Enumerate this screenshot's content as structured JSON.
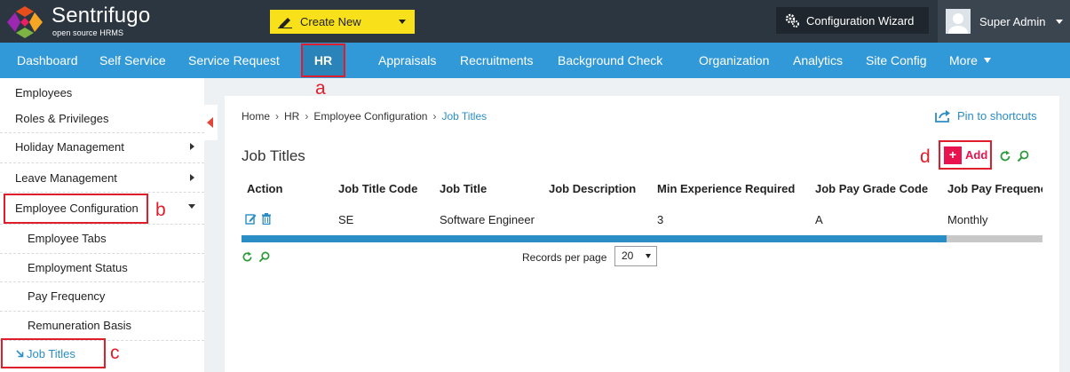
{
  "app": {
    "brand": "Sentrifugo",
    "tagline": "open source HRMS",
    "create_new": "Create New",
    "config_wizard": "Configuration Wizard",
    "user_name": "Super Admin"
  },
  "nav": {
    "items": [
      "Dashboard",
      "Self Service",
      "Service Request",
      "HR",
      "Appraisals",
      "Recruitments",
      "Background Check",
      "Organization",
      "Analytics",
      "Site Config",
      "More"
    ],
    "active": "HR"
  },
  "sidebar": {
    "items": [
      {
        "label": "Employees"
      },
      {
        "label": "Roles & Privileges"
      },
      {
        "label": "Holiday Management"
      },
      {
        "label": "Leave Management"
      },
      {
        "label": "Employee Configuration"
      },
      {
        "label": "Employee Tabs"
      },
      {
        "label": "Employment Status"
      },
      {
        "label": "Pay Frequency"
      },
      {
        "label": "Remuneration Basis"
      },
      {
        "label": "Job Titles"
      }
    ]
  },
  "breadcrumb": [
    "Home",
    "HR",
    "Employee Configuration",
    "Job Titles"
  ],
  "pin_label": "Pin to shortcuts",
  "page_title": "Job Titles",
  "add_label": "Add",
  "table": {
    "headers": [
      "Action",
      "Job Title Code",
      "Job Title",
      "Job Description",
      "Min Experience Required",
      "Job Pay Grade Code",
      "Job Pay Frequenc"
    ],
    "rows": [
      {
        "code": "SE",
        "title": "Software Engineer",
        "description": "",
        "min_experience": "3",
        "pay_grade": "A",
        "pay_frequency": "Monthly"
      }
    ]
  },
  "pagination": {
    "records_label": "Records per page",
    "records_value": "20"
  },
  "annotations": [
    "a",
    "b",
    "c",
    "d"
  ],
  "colors": {
    "topbar": "#2c3640",
    "navbar": "#3299d8",
    "accent_yellow": "#f8e11b",
    "annotation_red": "#e01e2b",
    "link_blue": "#2a8dc5",
    "add_pink": "#e8134e"
  }
}
